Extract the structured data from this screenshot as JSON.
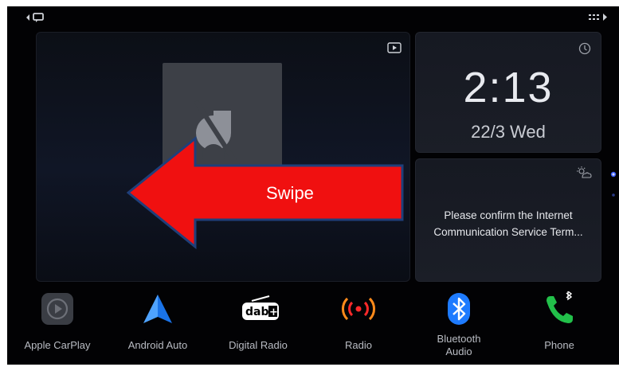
{
  "media": {
    "overlay_label": "Swipe",
    "source_icon": "play-icon",
    "album_icon": "music-note-off-icon"
  },
  "clock": {
    "time": "2:13",
    "date": "22/3  Wed",
    "icon": "clock-icon"
  },
  "notice": {
    "line1": "Please confirm the Internet",
    "line2": "Communication Service Term...",
    "icon": "weather-icon"
  },
  "dock": {
    "apps": [
      {
        "label": "Apple CarPlay",
        "icon": "carplay-icon"
      },
      {
        "label": "Android Auto",
        "icon": "android-auto-icon"
      },
      {
        "label": "Digital Radio",
        "icon": "dab-icon"
      },
      {
        "label": "Radio",
        "icon": "radio-icon"
      },
      {
        "label_line1": "Bluetooth",
        "label_line2": "Audio",
        "icon": "bluetooth-icon"
      },
      {
        "label": "Phone",
        "icon": "phone-icon"
      }
    ]
  },
  "colors": {
    "background": "#020204",
    "swipe_arrow": "#f01010",
    "swipe_arrow_outline": "#1f3f7a",
    "radio_accent": "#ff2a2a",
    "bluetooth_accent": "#1e7bff",
    "phone_accent": "#22c04a"
  }
}
